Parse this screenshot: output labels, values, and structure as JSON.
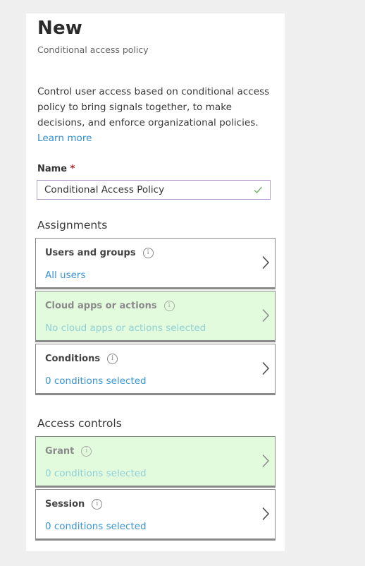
{
  "header": {
    "title": "New",
    "subtitle": "Conditional access policy"
  },
  "description": {
    "text": "Control user access based on conditional access policy to bring signals together, to make decisions, and enforce organizational policies.",
    "link_label": "Learn more"
  },
  "name_field": {
    "label": "Name",
    "required_marker": "*",
    "value": "Conditional Access Policy",
    "status_icon": "check-icon",
    "valid_color": "#6bb36b"
  },
  "assignments": {
    "header": "Assignments",
    "items": [
      {
        "title": "Users and groups",
        "value": "All users",
        "highlighted": false
      },
      {
        "title": "Cloud apps or actions",
        "value": "No cloud apps or actions selected",
        "highlighted": true
      },
      {
        "title": "Conditions",
        "value": "0 conditions selected",
        "highlighted": false
      }
    ]
  },
  "access_controls": {
    "header": "Access controls",
    "items": [
      {
        "title": "Grant",
        "value": "0 conditions selected",
        "highlighted": true
      },
      {
        "title": "Session",
        "value": "0 conditions selected",
        "highlighted": false
      }
    ]
  },
  "colors": {
    "link": "#2f8ccf",
    "highlight_background": "#e3fbdd",
    "required": "#a4262c",
    "input_border": "#b39cc9"
  }
}
